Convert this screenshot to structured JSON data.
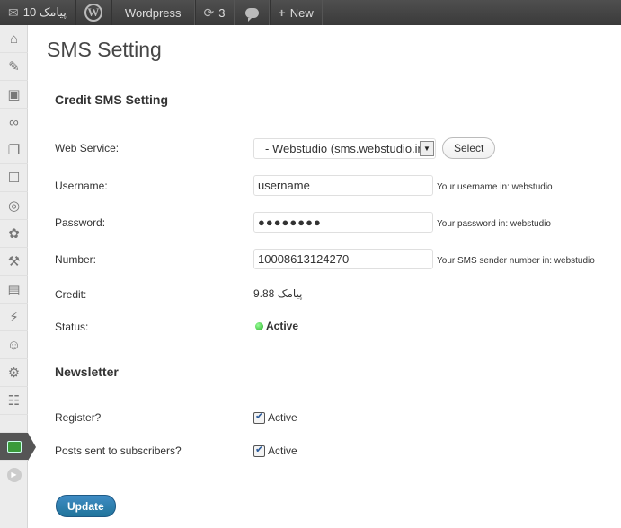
{
  "admin_bar": {
    "site_sms_label": "پیامک 10",
    "site_name": "Wordpress",
    "updates_count": "3",
    "new_label": "New"
  },
  "page": {
    "title": "SMS Setting"
  },
  "credit_section": {
    "title": "Credit SMS Setting",
    "web_service_label": "Web Service:",
    "web_service_value": "- Webstudio (sms.webstudio.ir)",
    "select_button": "Select",
    "username_label": "Username:",
    "username_value": "username",
    "username_hint": "Your username in: webstudio",
    "password_label": "Password:",
    "password_value": "●●●●●●●●",
    "password_hint": "Your password in: webstudio",
    "number_label": "Number:",
    "number_value": "10008613124270",
    "number_hint": "Your SMS sender number in: webstudio",
    "credit_label": "Credit:",
    "credit_value": "9.88 پیامک",
    "status_label": "Status:",
    "status_value": "Active"
  },
  "newsletter": {
    "title": "Newsletter",
    "register_label": "Register?",
    "register_check": "Active",
    "posts_label": "Posts sent to subscribers?",
    "posts_check": "Active"
  },
  "update_button": "Update",
  "colors": {
    "admin_bar": "#464646",
    "primary_button": "#21759b",
    "active_status": "#2a2"
  }
}
